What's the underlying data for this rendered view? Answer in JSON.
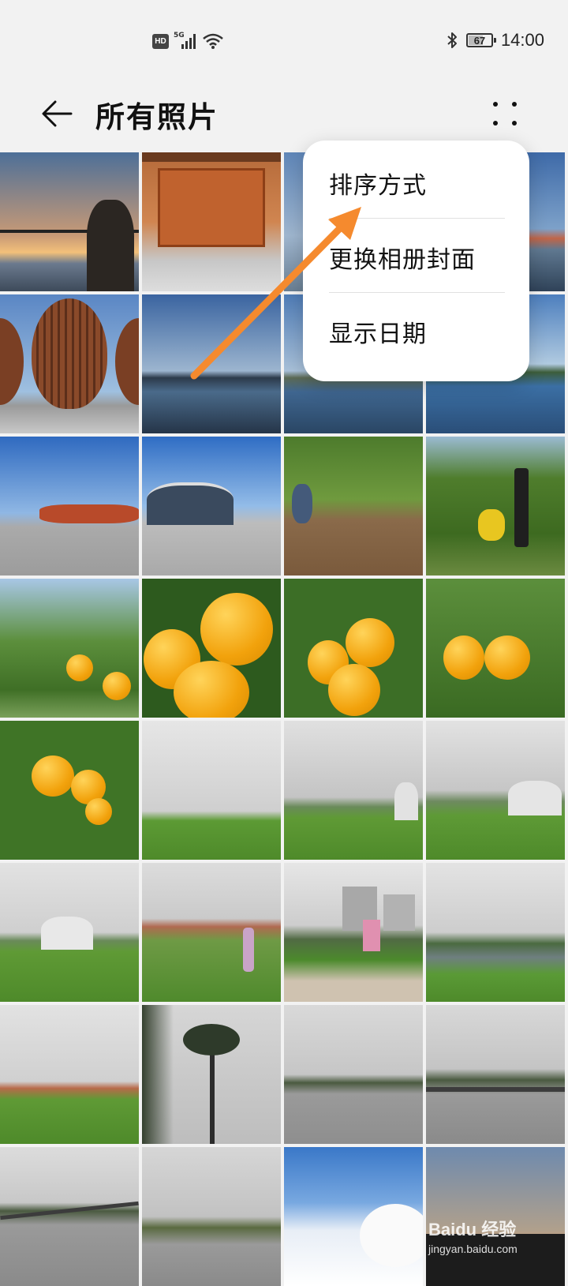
{
  "status_bar": {
    "network_badge": "HD",
    "network_gen": "5G",
    "battery_level": "67",
    "time": "14:00"
  },
  "header": {
    "title": "所有照片"
  },
  "menu": {
    "items": [
      "排序方式",
      "更换相册封面",
      "显示日期"
    ]
  },
  "photo_grid": {
    "rows": 8,
    "columns": 4
  },
  "watermark": {
    "brand": "Baidu 经验",
    "site": "jingyan.baidu.com"
  },
  "colors": {
    "background": "#f2f2f2",
    "menu_bg": "#ffffff",
    "annotation_arrow": "#f58a2e"
  }
}
